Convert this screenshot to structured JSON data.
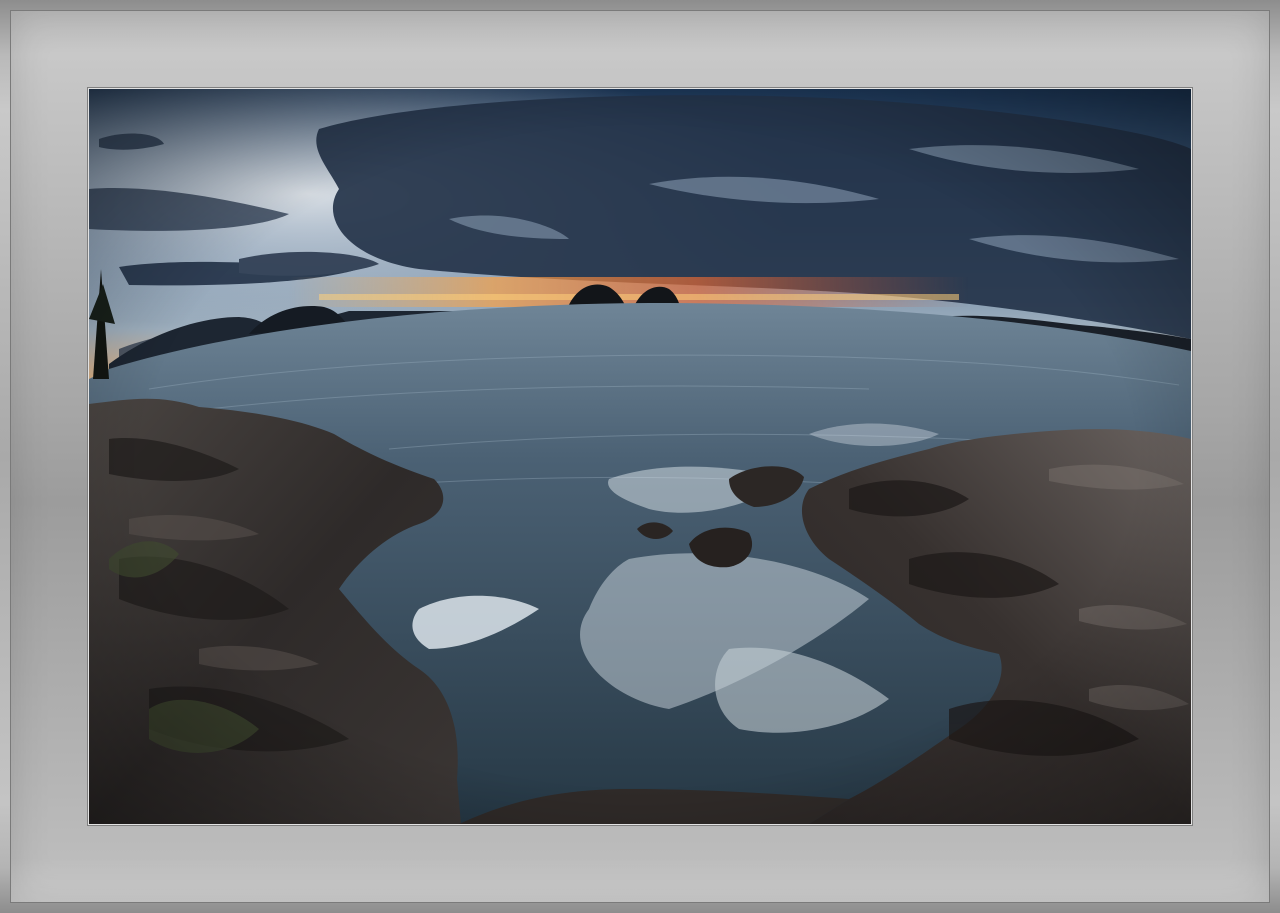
{
  "image": {
    "subject": "seascape-at-dusk",
    "colors": {
      "frame": "#a9a9a9",
      "sky_light": "#c7d7ea",
      "sky_dark": "#2a3748",
      "sunset_glow": "#f08a3c",
      "sea": "#3f5668",
      "rock": "#3a3634",
      "foam": "#e6eef4"
    }
  }
}
